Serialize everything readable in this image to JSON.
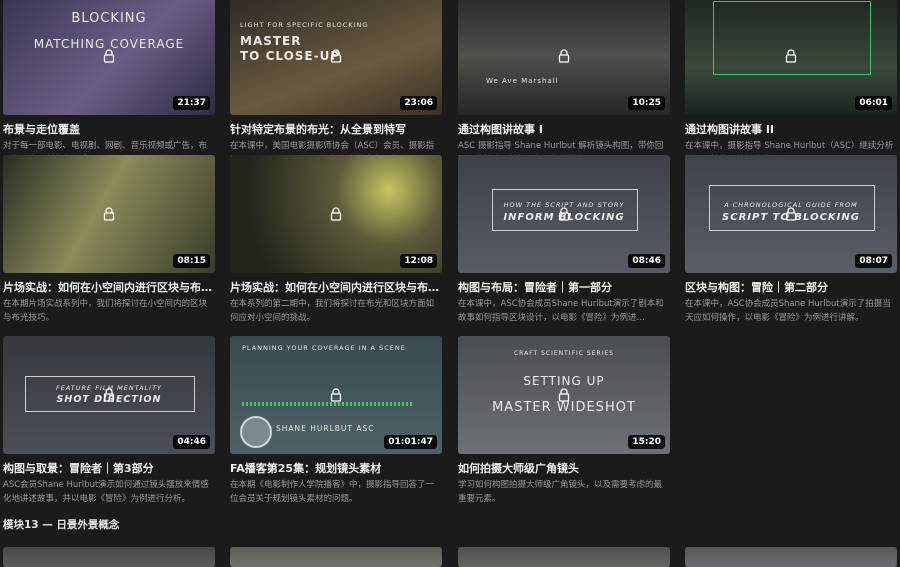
{
  "courses": [
    {
      "title": "布景与走位覆盖",
      "desc": "对于每一部电影、电视剧、网剧、音乐视频或广告，布景都是电影制作中最重要的方面之一。",
      "duration": "21:37",
      "overlay": [
        "BLOCKING",
        "MATCHING COVERAGE"
      ],
      "colors": [
        "#3c3552",
        "#6a5e86"
      ]
    },
    {
      "title": "针对特定布景的布光：从全景到特写",
      "desc": "在本课中，美国电影摄影师协会（ASC）会员、摄影指导 Shane Hurlbut 展示了如何为特定布景布光。",
      "duration": "23:06",
      "overlay": [
        "LIGHT FOR SPECIFIC BLOCKING",
        "MASTER",
        "TO CLOSE-UP"
      ],
      "colors": [
        "#2d2a25",
        "#6b5a3e"
      ]
    },
    {
      "title": "通过构图讲故事 I",
      "desc": "ASC 摄影指导 Shane Hurlbut 解析镜头构图，带你回顾经典镜头，并探讨如何打破常规。",
      "duration": "10:25",
      "overlay": [
        "We Ave Marshall"
      ],
      "colors": [
        "#2a2b2a",
        "#4e514c"
      ]
    },
    {
      "title": "通过构图讲故事 II",
      "desc": "在本课中，摄影指导 Shane Hurlbut（ASC）继续分析镜头及其背后的细微差别。",
      "duration": "06:01",
      "overlay": [],
      "colors": [
        "#1f2520",
        "#3a4a3c"
      ]
    },
    {
      "title": "片场实战：如何在小空间内进行区块与布光…",
      "desc": "在本期片场实战系列中，我们将探讨在小空间内的区块与布光技巧。",
      "duration": "08:15",
      "overlay": [],
      "colors": [
        "#2a2e22",
        "#8a8a5a"
      ]
    },
    {
      "title": "片场实战：如何在小空间内进行区块与布光…",
      "desc": "在本系列的第二期中，我们将探讨在布光和区块方面如何应对小空间的挑战。",
      "duration": "12:08",
      "overlay": [],
      "colors": [
        "#23241c",
        "#5b5a3a"
      ]
    },
    {
      "title": "构图与布局：冒险者｜第一部分",
      "desc": "在本课中，ASC协会成员Shane Hurlbut演示了剧本和故事如何指导区块设计，以电影《冒险》为例进…",
      "duration": "08:46",
      "overlay": [
        "HOW THE SCRIPT AND STORY",
        "INFORM BLOCKING"
      ],
      "colors": [
        "#3e4248",
        "#585d63"
      ]
    },
    {
      "title": "区块与构图：冒险｜第二部分",
      "desc": "在本课中，ASC协会成员Shane Hurlbut演示了拍摄当天应如何操作，以电影《冒险》为例进行讲解。",
      "duration": "08:07",
      "overlay": [
        "A CHRONOLOGICAL GUIDE FROM",
        "SCRIPT TO BLOCKING"
      ],
      "colors": [
        "#3f4349",
        "#5a5f66"
      ]
    },
    {
      "title": "构图与取景：冒险者｜第3部分",
      "desc": "ASC会员Shane Hurlbut演示如何通过镜头摆放来情感化地讲述故事，并以电影《冒险》为例进行分析。",
      "duration": "04:46",
      "overlay": [
        "FEATURE FILM MENTALITY",
        "SHOT DIRECTION"
      ],
      "colors": [
        "#35383d",
        "#4c5056"
      ]
    },
    {
      "title": "FA播客第25集：规划镜头素材",
      "desc": "在本期《电影制作人学院播客》中，摄影指导回答了一位会员关于规划镜头素材的问题。",
      "duration": "01:01:47",
      "overlay": [
        "PLANNING YOUR COVERAGE IN A SCENE",
        "SHANE HURLBUT ASC"
      ],
      "colors": [
        "#3a4a50",
        "#4d6268"
      ]
    },
    {
      "title": "如何拍摄大师级广角镜头",
      "desc": "学习如何构图拍摄大师级广角镜头，以及需要考虑的最重要元素。",
      "duration": "15:20",
      "overlay": [
        "CRAFT SCIENTIFIC SERIES",
        "SETTING UP",
        "MASTER WIDESHOT"
      ],
      "colors": [
        "#4a4d52",
        "#6d7075"
      ]
    }
  ],
  "section": {
    "title": "模块13 — 日景外景概念"
  },
  "next_row": [
    {
      "colors": [
        "#4a4a4a",
        "#5a5a5a"
      ]
    },
    {
      "colors": [
        "#5c5e58",
        "#6e7069"
      ]
    },
    {
      "colors": [
        "#50524e",
        "#62655f"
      ]
    },
    {
      "colors": [
        "#55575a",
        "#696b6f"
      ]
    }
  ]
}
